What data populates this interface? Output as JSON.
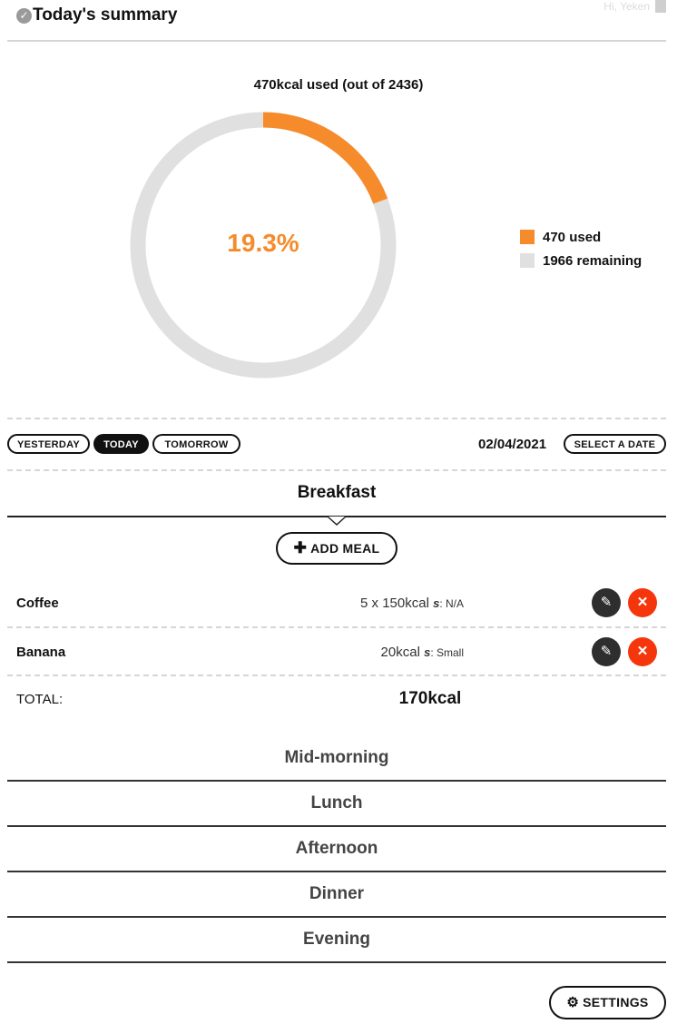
{
  "header": {
    "title": "Today's summary",
    "greeting": "Hi, Yeken"
  },
  "chart_data": {
    "type": "pie",
    "title": "470kcal used (out of 2436)",
    "center_label": "19.3%",
    "slices": [
      {
        "label": "470 used",
        "value": 470,
        "color": "#f68b2c"
      },
      {
        "label": "1966 remaining",
        "value": 1966,
        "color": "#e0e0e0"
      }
    ],
    "legend_position": "right"
  },
  "nav": {
    "yesterday": "YESTERDAY",
    "today": "TODAY",
    "tomorrow": "TOMORROW",
    "date": "02/04/2021",
    "select_date": "SELECT A DATE"
  },
  "breakfast": {
    "title": "Breakfast",
    "add_meal": "ADD MEAL",
    "items": [
      {
        "name": "Coffee",
        "amount": "5 x 150kcal",
        "size_label": "s",
        "size": ": N/A"
      },
      {
        "name": "Banana",
        "amount": "20kcal",
        "size_label": "s",
        "size": ": Small"
      }
    ],
    "total_label": "TOTAL:",
    "total_value": "170kcal"
  },
  "meals": [
    "Mid-morning",
    "Lunch",
    "Afternoon",
    "Dinner",
    "Evening"
  ],
  "settings_label": "SETTINGS",
  "icons": {
    "check": "check-circle-icon",
    "edit": "edit-icon",
    "delete": "close-icon",
    "plus": "plus-icon",
    "gear": "gear-icon"
  }
}
